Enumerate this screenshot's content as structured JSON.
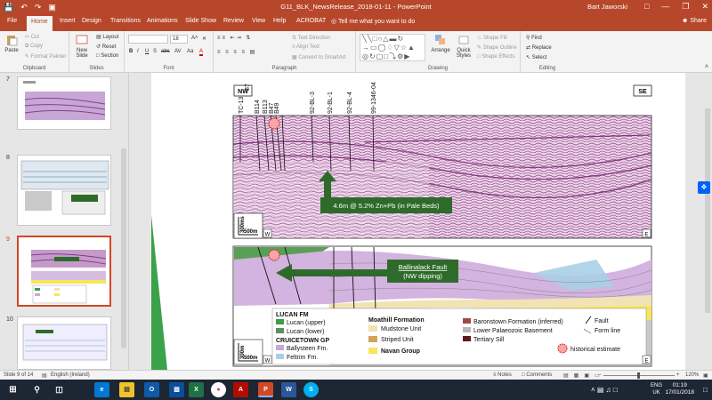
{
  "titlebar": {
    "doc_title": "G11_BLK_NewsRelease_2018-01-11 - PowerPoint",
    "user": "Bart Jaworski",
    "minimize": "—",
    "restore": "❐",
    "close": "✕",
    "save_icon": "save-icon",
    "undo_icon": "undo-icon",
    "redo_icon": "redo-icon",
    "start_icon": "slideshow-start-icon"
  },
  "tabs": {
    "items": [
      "File",
      "Home",
      "Insert",
      "Design",
      "Transitions",
      "Animations",
      "Slide Show",
      "Review",
      "View",
      "Help",
      "ACROBAT"
    ],
    "active": "Home",
    "tell_me": "Tell me what you want to do",
    "share": "Share"
  },
  "ribbon": {
    "clipboard": {
      "label": "Clipboard",
      "paste": "Paste",
      "cut": "Cut",
      "copy": "Copy",
      "format_painter": "Format Painter"
    },
    "slides": {
      "label": "Slides",
      "new_slide": "New Slide",
      "layout": "Layout",
      "reset": "Reset",
      "section": "Section"
    },
    "font": {
      "label": "Font",
      "size": "18",
      "buttons": [
        "B",
        "I",
        "U",
        "S",
        "abc",
        "AV",
        "Aa",
        "A"
      ]
    },
    "paragraph": {
      "label": "Paragraph",
      "text_direction": "Text Direction",
      "align_text": "Align Text",
      "convert_smartart": "Convert to SmartArt"
    },
    "drawing": {
      "label": "Drawing",
      "arrange": "Arrange",
      "quick_styles": "Quick Styles",
      "shape_fill": "Shape Fill",
      "shape_outline": "Shape Outline",
      "shape_effects": "Shape Effects"
    },
    "editing": {
      "label": "Editing",
      "find": "Find",
      "replace": "Replace",
      "select": "Select"
    }
  },
  "thumbnails": {
    "numbers": [
      "7",
      "8",
      "9",
      "10"
    ],
    "selected": "9"
  },
  "slide": {
    "top_section": {
      "nw": "NW",
      "se": "SE",
      "well_labels": [
        "TC-13",
        "87",
        "B114",
        "B113",
        "B47",
        "B49",
        "92-BL-3",
        "92-BL-1",
        "92-BL-4",
        "99-1346-04"
      ],
      "callout": "4.6m @ 5.2% Zn+Pb (in Pale Beds)",
      "scale_v": "300ms",
      "scale_h": "500m",
      "w": "W",
      "e": "E"
    },
    "bottom_section": {
      "fault_label_1": "Ballinalack Fault",
      "fault_label_2": "(NW dipping)",
      "scale_v": "300m",
      "scale_h": "500m",
      "w": "W",
      "e": "E",
      "legend": {
        "lucan_title": "LUCAN FM",
        "lucan_upper": "Lucan (upper)",
        "lucan_lower": "Lucan (lower)",
        "cruicetown_title": "CRUICETOWN GP",
        "ballysteen": "Ballysteen Fm.",
        "feltrim": "Feltrim Fm.",
        "moathill_title": "Moathill Formation",
        "mudstone": "Mudstone Unit",
        "striped": "Striped Unit",
        "navan": "Navan Group",
        "baronstown": "Baronstown Formation (inferred)",
        "lower_pal": "Lower Palaeozoic Basement",
        "tertiary": "Tertiary Sill",
        "fault": "Fault",
        "form_line": "Form line",
        "historical": "historical estimate"
      },
      "colors": {
        "lucan_upper": "#3f9a4a",
        "lucan_lower": "#5a8f5e",
        "ballysteen": "#c9a8d8",
        "feltrim": "#a9cfe6",
        "mudstone": "#f1e3b3",
        "striped": "#d4a05a",
        "navan": "#f5e65a",
        "baronstown": "#a34848",
        "lower_pal": "#b7b7b7",
        "tertiary": "#5e1a14"
      }
    }
  },
  "status": {
    "slide_info": "Slide 9 of 14",
    "language": "English (Ireland)",
    "notes": "Notes",
    "comments": "Comments",
    "zoom": "120%"
  },
  "taskbar": {
    "start_icon": "windows-start-icon",
    "search_icon": "search-icon",
    "taskview_icon": "task-view-icon",
    "lang_top": "ENG",
    "lang_bottom": "UK",
    "time": "01:19",
    "date": "17/01/2018"
  }
}
